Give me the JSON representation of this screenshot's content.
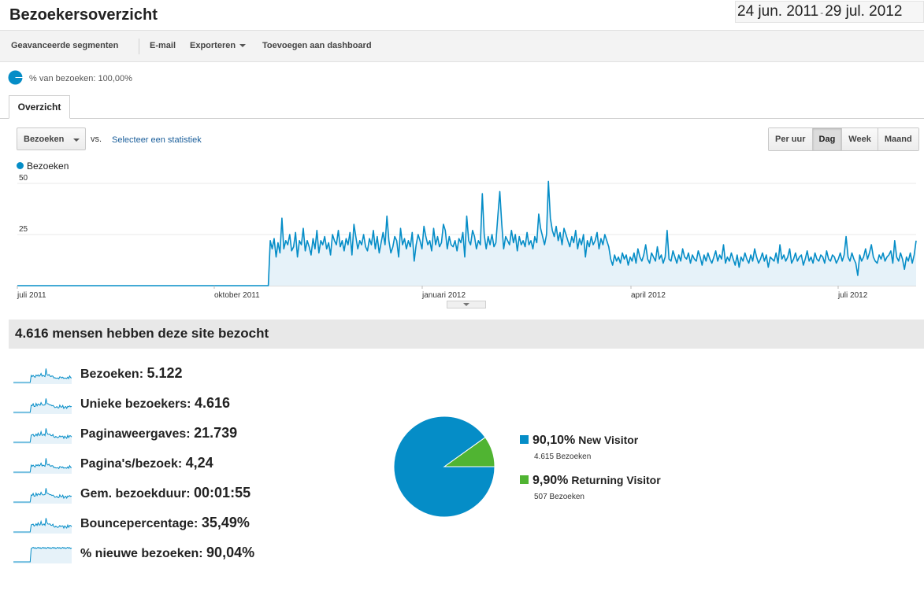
{
  "header": {
    "title": "Bezoekersoverzicht",
    "date_start": "24 jun. 2011",
    "date_sep": "-",
    "date_end": "29 jul. 2012"
  },
  "toolbar": {
    "advanced_segments": "Geavanceerde segmenten",
    "email": "E-mail",
    "export": "Exporteren",
    "add_dashboard": "Toevoegen aan dashboard"
  },
  "segment": {
    "label": "% van bezoeken: 100,00%"
  },
  "tabs": {
    "overview": "Overzicht"
  },
  "controls": {
    "metric": "Bezoeken",
    "vs": "vs.",
    "select_stat": "Selecteer een statistiek",
    "granularity": [
      {
        "label": "Per uur",
        "active": false
      },
      {
        "label": "Dag",
        "active": true
      },
      {
        "label": "Week",
        "active": false
      },
      {
        "label": "Maand",
        "active": false
      }
    ]
  },
  "chart_data": {
    "type": "area",
    "series": [
      {
        "name": "Bezoeken",
        "color": "#058dc7",
        "values": [
          0,
          0,
          0,
          0,
          0,
          0,
          0,
          0,
          0,
          0,
          0,
          0,
          0,
          0,
          0,
          0,
          0,
          0,
          0,
          0,
          0,
          0,
          0,
          0,
          0,
          0,
          0,
          0,
          0,
          0,
          0,
          0,
          0,
          0,
          0,
          0,
          0,
          0,
          0,
          0,
          0,
          0,
          0,
          0,
          0,
          0,
          0,
          0,
          0,
          0,
          0,
          0,
          0,
          0,
          0,
          0,
          0,
          0,
          0,
          0,
          0,
          0,
          0,
          0,
          0,
          0,
          0,
          0,
          0,
          0,
          0,
          0,
          0,
          0,
          0,
          0,
          0,
          0,
          0,
          0,
          0,
          0,
          0,
          0,
          0,
          0,
          0,
          0,
          0,
          0,
          0,
          0,
          0,
          0,
          0,
          0,
          0,
          0,
          0,
          0,
          0,
          0,
          0,
          0,
          0,
          0,
          0,
          0,
          0,
          0,
          0,
          0,
          0,
          0,
          0,
          0,
          0,
          0,
          0,
          0,
          0,
          0,
          0,
          0,
          0,
          0,
          0,
          0,
          0,
          0,
          22,
          18,
          23,
          14,
          21,
          16,
          33,
          18,
          22,
          20,
          25,
          17,
          19,
          26,
          14,
          22,
          20,
          28,
          17,
          22,
          19,
          15,
          23,
          18,
          27,
          16,
          22,
          20,
          24,
          18,
          21,
          15,
          25,
          22,
          20,
          27,
          19,
          22,
          17,
          23,
          20,
          26,
          15,
          30,
          24,
          18,
          22,
          20,
          25,
          19,
          17,
          23,
          20,
          27,
          18,
          24,
          16,
          21,
          26,
          20,
          34,
          22,
          16,
          19,
          24,
          22,
          14,
          28,
          20,
          23,
          18,
          22,
          19,
          26,
          12,
          20,
          25,
          22,
          18,
          29,
          24,
          20,
          22,
          17,
          28,
          20,
          24,
          19,
          21,
          30,
          27,
          18,
          24,
          20,
          19,
          22,
          17,
          23,
          21,
          26,
          14,
          34,
          22,
          20,
          27,
          24,
          18,
          22,
          20,
          45,
          25,
          18,
          24,
          20,
          25,
          19,
          21,
          34,
          46,
          30,
          18,
          24,
          22,
          20,
          27,
          21,
          25,
          17,
          24,
          20,
          22,
          19,
          26,
          20,
          22,
          18,
          24,
          21,
          35,
          28,
          24,
          20,
          25,
          51,
          33,
          27,
          24,
          29,
          22,
          26,
          20,
          28,
          25,
          22,
          19,
          24,
          21,
          27,
          18,
          23,
          20,
          25,
          14,
          22,
          19,
          24,
          20,
          22,
          26,
          18,
          23,
          20,
          25,
          22,
          19,
          13,
          10,
          15,
          12,
          14,
          11,
          16,
          13,
          15,
          10,
          14,
          12,
          16,
          11,
          18,
          14,
          12,
          15,
          20,
          13,
          11,
          16,
          14,
          12,
          19,
          13,
          15,
          11,
          14,
          27,
          13,
          12,
          17,
          14,
          11,
          15,
          12,
          18,
          14,
          13,
          16,
          11,
          15,
          13,
          12,
          17,
          14,
          10,
          15,
          12,
          16,
          13,
          11,
          14,
          17,
          12,
          15,
          13,
          20,
          11,
          14,
          12,
          16,
          13,
          10,
          15,
          9,
          14,
          12,
          16,
          13,
          11,
          15,
          12,
          18,
          14,
          11,
          13,
          16,
          12,
          15,
          9,
          14,
          13,
          12,
          16,
          11,
          20,
          13,
          15,
          12,
          14,
          18,
          11,
          13,
          16,
          12,
          14,
          15,
          10,
          13,
          17,
          12,
          14,
          11,
          16,
          13,
          12,
          15,
          14,
          11,
          17,
          13,
          12,
          15,
          14,
          11,
          13,
          16,
          12,
          15,
          24,
          14,
          12,
          16,
          13,
          11,
          5,
          15,
          12,
          14,
          18,
          13,
          16,
          20,
          14,
          12,
          11,
          15,
          13,
          16,
          12,
          14,
          15,
          17,
          11,
          22,
          14,
          12,
          16,
          13,
          8,
          14,
          12,
          16,
          11,
          15,
          22
        ]
      }
    ],
    "x_ticks": [
      "juli 2011",
      "oktober 2011",
      "januari 2012",
      "april 2012",
      "juli 2012"
    ],
    "y_ticks": [
      25,
      50
    ],
    "ylim": [
      0,
      50
    ],
    "grid": true
  },
  "summary": {
    "headline": "4.616 mensen hebben deze site bezocht",
    "metrics": [
      {
        "label": "Bezoeken:",
        "value": "5.122"
      },
      {
        "label": "Unieke bezoekers:",
        "value": "4.616"
      },
      {
        "label": "Paginaweergaves:",
        "value": "21.739"
      },
      {
        "label": "Pagina's/bezoek:",
        "value": "4,24"
      },
      {
        "label": "Gem. bezoekduur:",
        "value": "00:01:55"
      },
      {
        "label": "Bouncepercentage:",
        "value": "35,49%"
      },
      {
        "label": "% nieuwe bezoeken:",
        "value": "90,04%"
      }
    ]
  },
  "pie": {
    "slices": [
      {
        "pct_value": 90.1,
        "pct": "90,10%",
        "name": "New Visitor",
        "count": "4.615 Bezoeken",
        "color": "#058dc7"
      },
      {
        "pct_value": 9.9,
        "pct": "9,90%",
        "name": "Returning Visitor",
        "count": "507 Bezoeken",
        "color": "#50b432"
      }
    ]
  }
}
